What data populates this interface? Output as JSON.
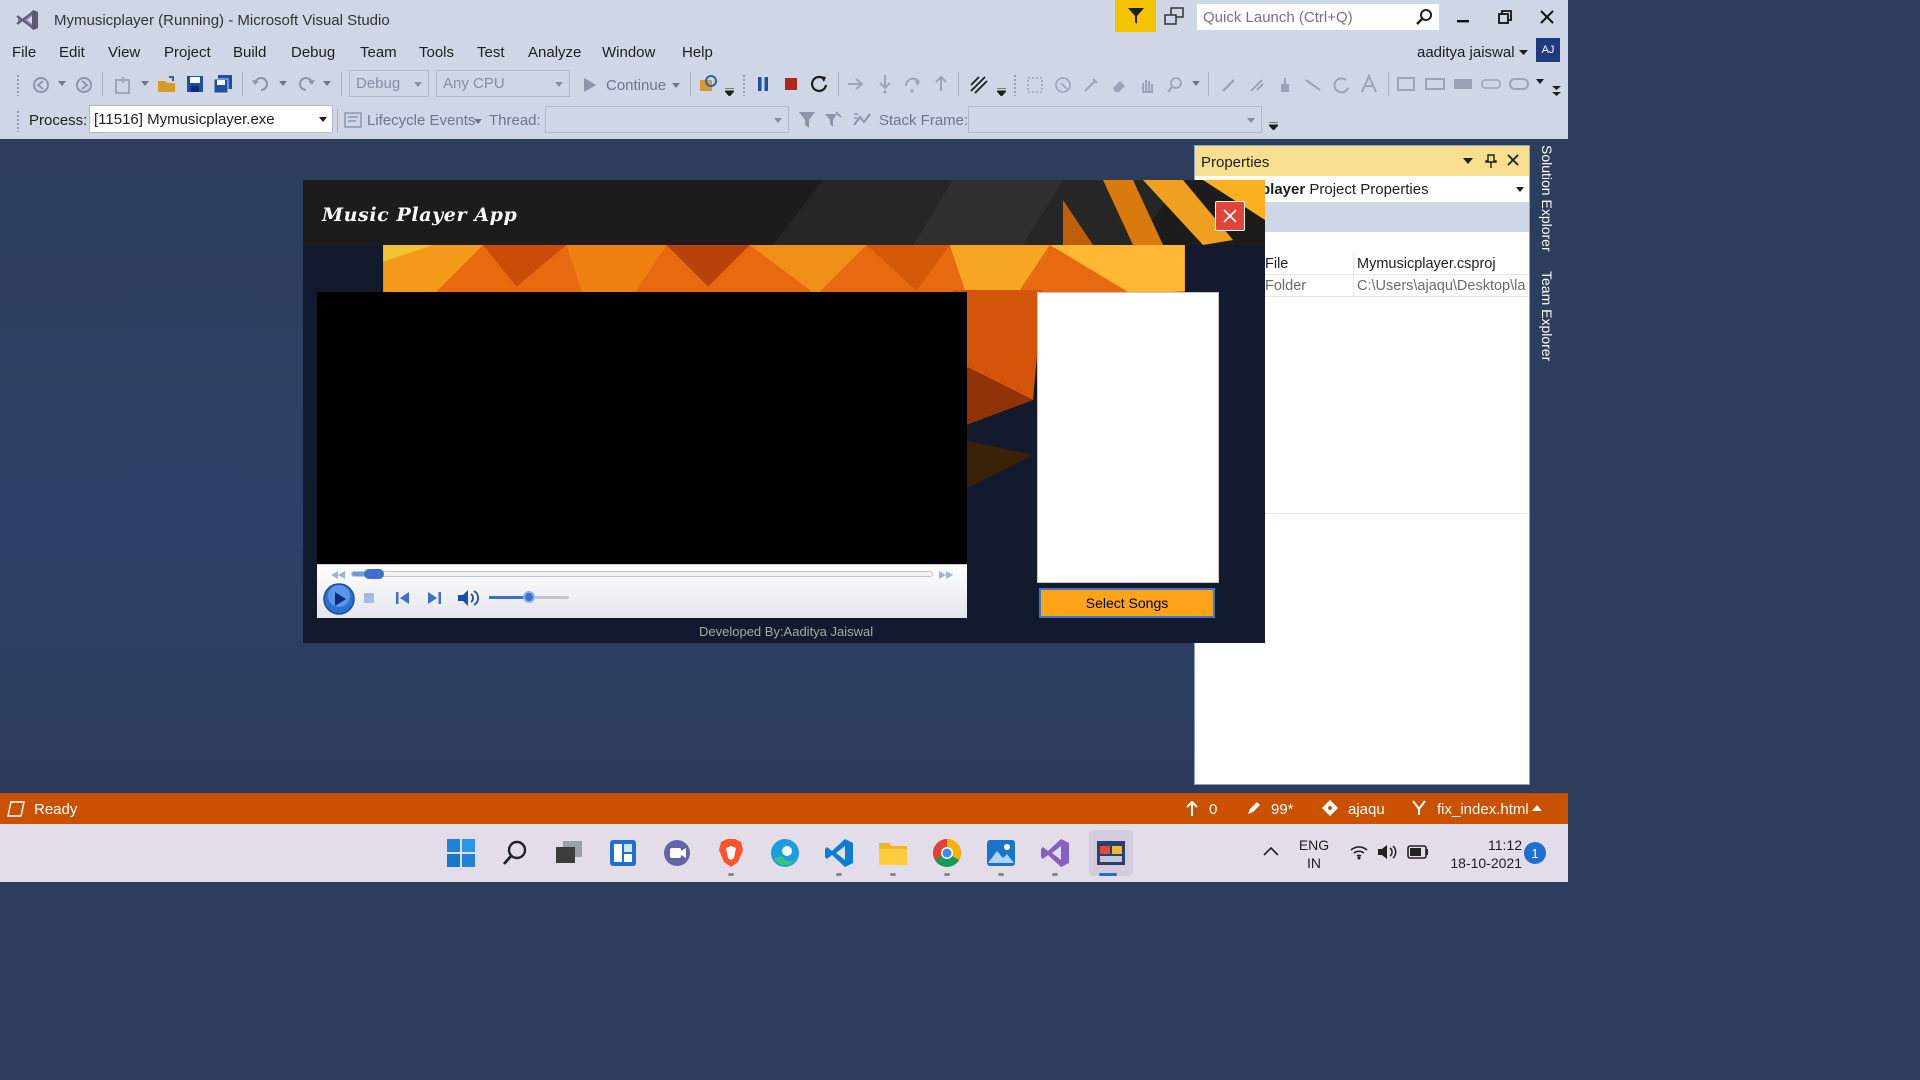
{
  "colors": {
    "vs_chrome": "#cfd7e6",
    "workspace": "#2c3d5d",
    "statusbar": "#ca5100",
    "props_header": "#f6df8f",
    "accent_yellow": "#f5c400",
    "select_button": "#ffa31a",
    "close_red": "#e0443a",
    "taskbar": "#e2dde9"
  },
  "window": {
    "title": "Mymusicplayer (Running) - Microsoft Visual Studio",
    "quick_launch_placeholder": "Quick Launch (Ctrl+Q)",
    "icons": [
      "vs-logo-icon",
      "filter-icon",
      "feedback-icon",
      "search-icon",
      "minimize-icon",
      "restore-icon",
      "close-icon"
    ]
  },
  "menu": {
    "items": [
      "File",
      "Edit",
      "View",
      "Project",
      "Build",
      "Debug",
      "Team",
      "Tools",
      "Test",
      "Analyze",
      "Window",
      "Help"
    ],
    "user": "aaditya jaiswal",
    "avatar": "AJ"
  },
  "toolbar": {
    "config": "Debug",
    "platform": "Any CPU",
    "continue": "Continue"
  },
  "debug_toolbar": {
    "process_label": "Process:",
    "process_value": "[11516] Mymusicplayer.exe",
    "lifecycle": "Lifecycle Events",
    "thread_label": "Thread:",
    "thread_value": "",
    "stack_label": "Stack Frame:",
    "stack_value": ""
  },
  "properties": {
    "title": "Properties",
    "object_bold": "player",
    "object_rest": " Project Properties",
    "rows": [
      {
        "key": "File",
        "value": "Mymusicplayer.csproj"
      },
      {
        "key": "Folder",
        "value": "C:\\Users\\ajaqu\\Desktop\\la"
      }
    ]
  },
  "side_tabs": [
    "Solution Explorer",
    "Team Explorer"
  ],
  "app": {
    "title": "Music Player App",
    "select_button": "Select Songs",
    "credit": "Developed By:Aaditya Jaiswal",
    "seek_position": 0.02,
    "volume_level": 0.5,
    "playlist_items": []
  },
  "statusbar": {
    "ready": "Ready",
    "up_count": "0",
    "pending_changes": "99*",
    "repo_user": "ajaqu",
    "branch": "fix_index.html"
  },
  "taskbar": {
    "apps": [
      "windows-start-icon",
      "search-icon",
      "task-view-icon",
      "widgets-icon",
      "teams-chat-icon",
      "brave-icon",
      "edge-icon",
      "vscode-icon",
      "file-explorer-icon",
      "chrome-icon",
      "photos-icon",
      "visual-studio-icon",
      "winforms-app-icon"
    ],
    "lang_top": "ENG",
    "lang_bottom": "IN",
    "time": "11:12",
    "date": "18-10-2021",
    "notifications": "1"
  }
}
